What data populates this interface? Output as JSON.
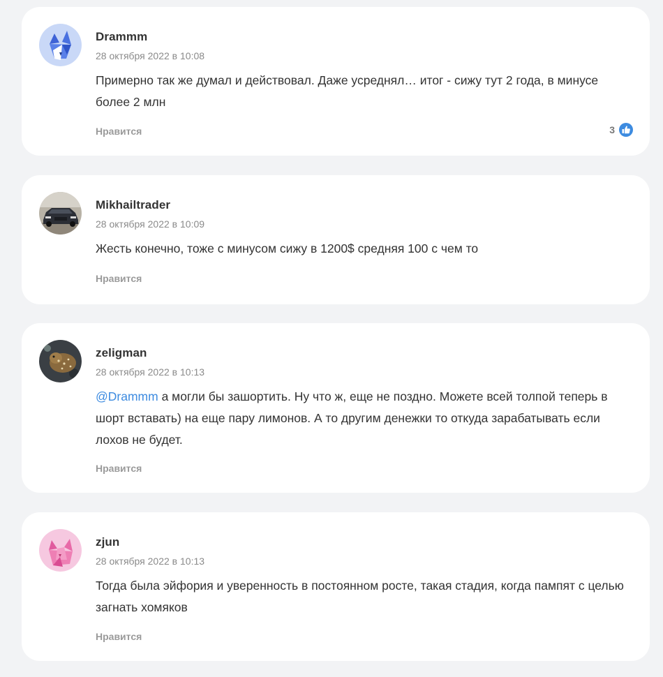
{
  "comments": [
    {
      "author": "Drammm",
      "date": "28 октября 2022 в 10:08",
      "text": "Примерно так же думал и действовал. Даже усреднял… итог - сижу тут 2 года, в минусе более 2 млн",
      "like_label": "Нравится",
      "likes": "3",
      "avatar": "fox-avatar"
    },
    {
      "author": "Mikhailtrader",
      "date": "28 октября 2022 в 10:09",
      "text": "Жесть конечно, тоже с минусом сижу в 1200$ средняя 100 с чем то",
      "like_label": "Нравится",
      "avatar": "car-photo-avatar"
    },
    {
      "author": "zeligman",
      "date": "28 октября 2022 в 10:13",
      "mention": "@Drammm",
      "text": " а могли бы зашортить. Ну что ж, еще не поздно. Можете всей толпой теперь в шорт вставать) на еще пару лимонов. А то другим денежки то откуда зарабатывать если лохов не будет.",
      "like_label": "Нравится",
      "avatar": "animal-photo-avatar"
    },
    {
      "author": "zjun",
      "date": "28 октября 2022 в 10:13",
      "text": "Тогда была эйфория и уверенность в постоянном росте, такая стадия, когда пампят с целью загнать хомяков",
      "like_label": "Нравится",
      "avatar": "cat-avatar"
    }
  ],
  "colors": {
    "page_bg": "#f2f3f5",
    "card_bg": "#ffffff",
    "mention": "#3d8be0",
    "like_icon": "#3d8be0"
  }
}
